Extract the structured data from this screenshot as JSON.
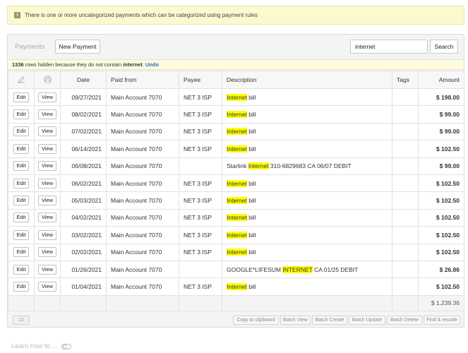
{
  "alert": {
    "text": "There is one or more uncategorized payments which can be categorized using payment rules"
  },
  "toolbar": {
    "title": "Payments",
    "new_payment": "New Payment",
    "search_value": "internet",
    "search_button": "Search"
  },
  "notice": {
    "count": "1336",
    "text_before": " rows hidden because they do not contain ",
    "term": "internet",
    "text_after": ".",
    "undo": "Undo"
  },
  "table": {
    "headers": {
      "date": "Date",
      "paid_from": "Paid from",
      "payee": "Payee",
      "description": "Description",
      "tags": "Tags",
      "amount": "Amount"
    },
    "edit_label": "Edit",
    "view_label": "View",
    "rows": [
      {
        "date": "09/27/2021",
        "paid_from": "Main Account 7070",
        "payee": "NET 3 ISP",
        "desc_pre": "",
        "desc_hl": "Internet",
        "desc_post": " bill",
        "amount": "$ 198.00"
      },
      {
        "date": "08/02/2021",
        "paid_from": "Main Account 7070",
        "payee": "NET 3 ISP",
        "desc_pre": "",
        "desc_hl": "Internet",
        "desc_post": " bill",
        "amount": "$ 99.00"
      },
      {
        "date": "07/02/2021",
        "paid_from": "Main Account 7070",
        "payee": "NET 3 ISP",
        "desc_pre": "",
        "desc_hl": "Internet",
        "desc_post": " bill",
        "amount": "$ 99.00"
      },
      {
        "date": "06/14/2021",
        "paid_from": "Main Account 7070",
        "payee": "NET 3 ISP",
        "desc_pre": "",
        "desc_hl": "Internet",
        "desc_post": " bill",
        "amount": "$ 102.50"
      },
      {
        "date": "06/08/2021",
        "paid_from": "Main Account 7070",
        "payee": "",
        "desc_pre": "Starlink ",
        "desc_hl": "Internet",
        "desc_post": " 310-6829683 CA 06/07 DEBIT",
        "amount": "$ 99.00"
      },
      {
        "date": "06/02/2021",
        "paid_from": "Main Account 7070",
        "payee": "NET 3 ISP",
        "desc_pre": "",
        "desc_hl": "Internet",
        "desc_post": " bill",
        "amount": "$ 102.50"
      },
      {
        "date": "05/03/2021",
        "paid_from": "Main Account 7070",
        "payee": "NET 3 ISP",
        "desc_pre": "",
        "desc_hl": "Internet",
        "desc_post": " bill",
        "amount": "$ 102.50"
      },
      {
        "date": "04/02/2021",
        "paid_from": "Main Account 7070",
        "payee": "NET 3 ISP",
        "desc_pre": "",
        "desc_hl": "Internet",
        "desc_post": " bill",
        "amount": "$ 102.50"
      },
      {
        "date": "03/02/2021",
        "paid_from": "Main Account 7070",
        "payee": "NET 3 ISP",
        "desc_pre": "",
        "desc_hl": "Internet",
        "desc_post": " bill",
        "amount": "$ 102.50"
      },
      {
        "date": "02/02/2021",
        "paid_from": "Main Account 7070",
        "payee": "NET 3 ISP",
        "desc_pre": "",
        "desc_hl": "Internet",
        "desc_post": " bill",
        "amount": "$ 102.50"
      },
      {
        "date": "01/26/2021",
        "paid_from": "Main Account 7070",
        "payee": "",
        "desc_pre": "GOOGLE*LIFESUM ",
        "desc_hl": "INTERNET",
        "desc_post": " CA 01/25 DEBIT",
        "amount": "$ 26.86"
      },
      {
        "date": "01/04/2021",
        "paid_from": "Main Account 7070",
        "payee": "NET 3 ISP",
        "desc_pre": "",
        "desc_hl": "Internet",
        "desc_post": " bill",
        "amount": "$ 102.50"
      }
    ],
    "total": "$ 1,239.36"
  },
  "footer": {
    "count": "12",
    "buttons": [
      "Copy to clipboard",
      "Batch View",
      "Batch Create",
      "Batch Update",
      "Batch Delete",
      "Find & recode"
    ]
  },
  "learn": {
    "text": "Learn how to ..."
  }
}
